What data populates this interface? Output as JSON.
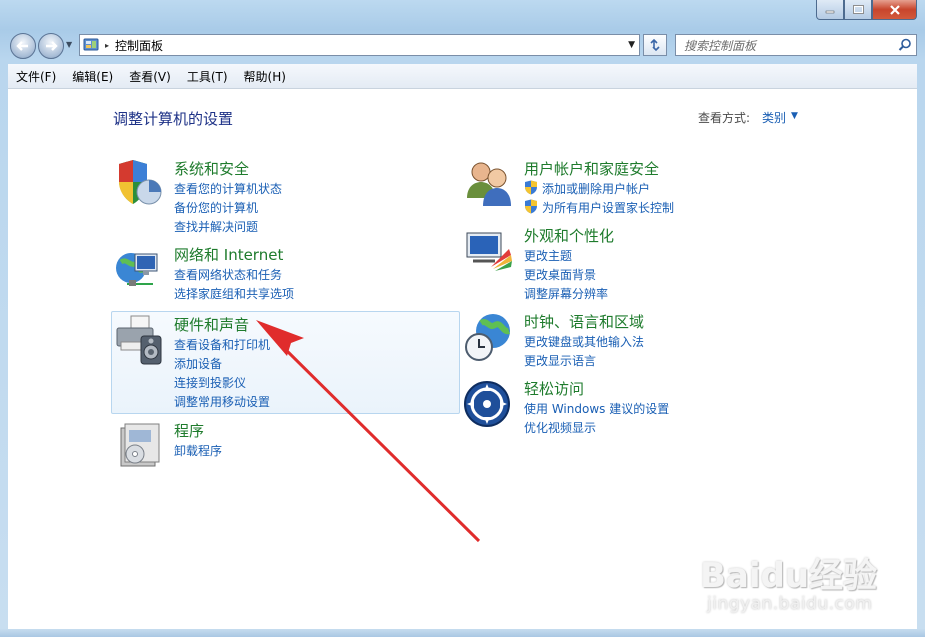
{
  "window": {
    "minimize_icon": "minimize-icon",
    "maximize_icon": "maximize-icon",
    "close_icon": "close-icon"
  },
  "address": {
    "breadcrumb": "控制面板",
    "separator": "▸"
  },
  "search": {
    "placeholder": "搜索控制面板"
  },
  "menu": {
    "items": [
      "文件(F)",
      "编辑(E)",
      "查看(V)",
      "工具(T)",
      "帮助(H)"
    ]
  },
  "page": {
    "title": "调整计算机的设置",
    "view_by_label": "查看方式:",
    "view_by_value": "类别"
  },
  "categories": {
    "system": {
      "title": "系统和安全",
      "links": [
        "查看您的计算机状态",
        "备份您的计算机",
        "查找并解决问题"
      ]
    },
    "network": {
      "title": "网络和 Internet",
      "links": [
        "查看网络状态和任务",
        "选择家庭组和共享选项"
      ]
    },
    "hardware": {
      "title": "硬件和声音",
      "links": [
        "查看设备和打印机",
        "添加设备",
        "连接到投影仪",
        "调整常用移动设置"
      ]
    },
    "programs": {
      "title": "程序",
      "links": [
        "卸载程序"
      ]
    },
    "users": {
      "title": "用户帐户和家庭安全",
      "links": [
        "添加或删除用户帐户",
        "为所有用户设置家长控制"
      ]
    },
    "appearance": {
      "title": "外观和个性化",
      "links": [
        "更改主题",
        "更改桌面背景",
        "调整屏幕分辨率"
      ]
    },
    "clock": {
      "title": "时钟、语言和区域",
      "links": [
        "更改键盘或其他输入法",
        "更改显示语言"
      ]
    },
    "access": {
      "title": "轻松访问",
      "links": [
        "使用 Windows 建议的设置",
        "优化视频显示"
      ]
    }
  },
  "watermark": {
    "logo": "Baidu经验",
    "url": "jingyan.baidu.com"
  },
  "colors": {
    "title_green": "#1e7b2c",
    "link_blue": "#1a5fb4",
    "arrow_red": "#e02c2c"
  }
}
